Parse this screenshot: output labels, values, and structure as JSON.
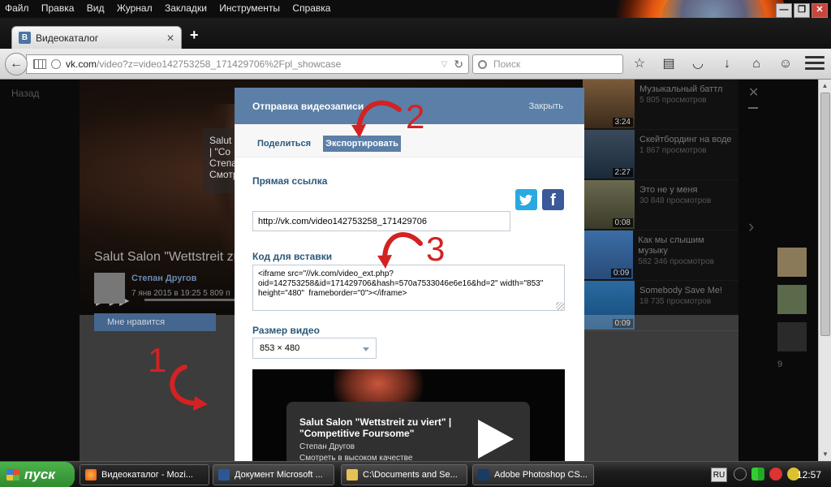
{
  "menubar": {
    "items": [
      "Файл",
      "Правка",
      "Вид",
      "Журнал",
      "Закладки",
      "Инструменты",
      "Справка"
    ]
  },
  "window_buttons": {
    "minimize": "—",
    "restore": "❐",
    "close": "✕"
  },
  "tab": {
    "title": "Видеокаталог",
    "favicon": "B"
  },
  "address": {
    "url_host": "vk.com",
    "url_path": "/video?z=video142753258_171429706%2Fpl_showcase",
    "search_placeholder": "Поиск"
  },
  "page": {
    "back_link": "Назад",
    "player_info": "Salut\n| \"Co\nСтепан\nСмотр",
    "video_title": "Salut Salon \"Wettstreit zu",
    "author_name": "Степан Другов",
    "author_date": "7 янв 2015 в 19:25  5 809 п",
    "like_label": "Мне нравится",
    "related": [
      {
        "title": "Музыкальный баттл",
        "views": "5 805 просмотров",
        "duration": "3:24"
      },
      {
        "title": "Скейтбординг на воде",
        "views": "1 867 просмотров",
        "duration": "2:27"
      },
      {
        "title": "Это не у меня",
        "views": "30 848 просмотров",
        "duration": "0:08"
      },
      {
        "title": "Как мы слышим музыку",
        "views": "582 346 просмотров",
        "duration": "0:09"
      },
      {
        "title": "Somebody Save Me!",
        "views": "18 735 просмотров",
        "duration": "0:09"
      }
    ],
    "side_count": "9"
  },
  "modal": {
    "title": "Отправка видеозаписи",
    "close_label": "Закрыть",
    "tab_share": "Поделиться",
    "tab_export": "Экспортировать",
    "direct_link_label": "Прямая ссылка",
    "direct_link_value": "http://vk.com/video142753258_171429706",
    "embed_label": "Код для вставки",
    "embed_code": "<iframe src=\"//vk.com/video_ext.php?oid=142753258&id=171429706&hash=570a7533046e6e16&hd=2\" width=\"853\" height=\"480\"  frameborder=\"0\"></iframe>",
    "size_label": "Размер видео",
    "size_value": "853 × 480",
    "preview": {
      "title": "Salut Salon \"Wettstreit zu viert\" | \"Competitive Foursome\"",
      "author": "Степан Другов",
      "quality": "Смотреть в высоком качестве"
    }
  },
  "annotations": {
    "one": "1",
    "two": "2",
    "three": "3",
    "color": "#d32222"
  },
  "taskbar": {
    "start_label": "пуск",
    "items": [
      "Видеокаталог - Mozi...",
      "Документ Microsoft ...",
      "C:\\Documents and Se...",
      "Adobe Photoshop CS..."
    ],
    "lang": "RU",
    "clock": "12:57"
  },
  "colors": {
    "vk_blue": "#5b7fa6",
    "vk_link": "#2b587a",
    "twitter": "#2aa9e0",
    "facebook": "#3b5998"
  },
  "icons": [
    "vk-favicon",
    "back-arrow-icon",
    "reload-icon",
    "search-icon",
    "star-icon",
    "list-icon",
    "pocket-icon",
    "download-icon",
    "home-icon",
    "smiley-icon",
    "menu-icon",
    "twitter-icon",
    "facebook-icon",
    "play-icon"
  ]
}
